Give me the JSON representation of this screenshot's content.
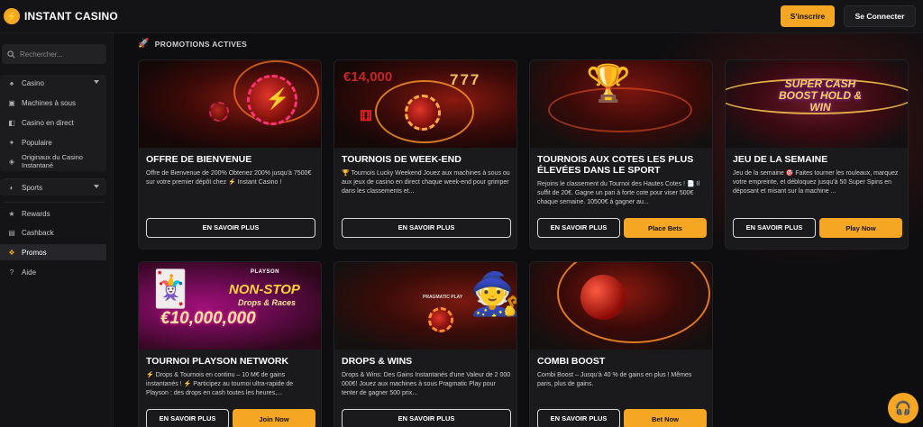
{
  "brand": {
    "name": "INSTANT CASINO",
    "logo_glyph": "⚡"
  },
  "header": {
    "signup_label": "S'inscrire",
    "login_label": "Se Connecter"
  },
  "sidebar": {
    "search_placeholder": "Rechercher...",
    "casino": {
      "label": "Casino",
      "items": [
        {
          "label": "Machines à sous",
          "icon": "slot-machine-icon"
        },
        {
          "label": "Casino en direct",
          "icon": "live-casino-icon"
        },
        {
          "label": "Populaire",
          "icon": "sparkle-icon"
        },
        {
          "label": "Originaux du Casino Instantané",
          "icon": "originals-icon"
        }
      ]
    },
    "sports": {
      "label": "Sports"
    },
    "items": [
      {
        "label": "Rewards",
        "icon": "star-icon"
      },
      {
        "label": "Cashback",
        "icon": "cashback-icon"
      },
      {
        "label": "Promos",
        "icon": "promo-icon",
        "active": true
      },
      {
        "label": "Aide",
        "icon": "help-icon"
      }
    ]
  },
  "main": {
    "section_title": "PROMOTIONS ACTIVES",
    "cards": [
      {
        "title": "OFFRE DE BIENVENUE",
        "description": "Offre de Bienvenue de 200% Obtenez 200% jusqu'à 7500€ sur votre premier dépôt chez ⚡ Instant Casino !",
        "outline_label": "EN SAVOIR PLUS"
      },
      {
        "title": "TOURNOIS DE WEEK-END",
        "image_text": "€14,000",
        "description": "🏆 Tournois Lucky Weekend Jouez aux machines à sous ou aux jeux de casino en direct chaque week-end pour grimper dans les classements et...",
        "outline_label": "EN SAVOIR PLUS"
      },
      {
        "title": "TOURNOIS AUX COTES LES PLUS ÉLEVÉES DANS LE SPORT",
        "description": "Rejoins le classement du Tournoi des Hautes Cotes ! 📄 Il suffit de 20€. Gagne un pari à forte cote pour viser 500€ chaque semaine. 10500€ à gagner au...",
        "outline_label": "EN SAVOIR PLUS",
        "gold_label": "Place Bets"
      },
      {
        "title": "JEU DE LA SEMAINE",
        "image_text": "SUPER CASH BOOST HOLD & WIN",
        "description": "Jeu de la semaine 🎯 Faites tourner les rouleaux, marquez votre empreinte, et débloquez jusqu'à 50 Super Spins en déposant et misant sur la machine ...",
        "outline_label": "EN SAVOIR PLUS",
        "gold_label": "Play Now"
      },
      {
        "title": "TOURNOI PLAYSON NETWORK",
        "image_brand": "PLAYSON",
        "image_headline": "NON-STOP",
        "image_subline": "Drops & Races",
        "image_amount": "€10,000,000",
        "description": "⚡ Drops & Tournois en continu – 10 M€ de gains instantanés ! ⚡ Participez au tournoi ultra-rapide de Playson : des drops en cash toutes les heures,...",
        "outline_label": "EN SAVOIR PLUS",
        "gold_label": "Join Now"
      },
      {
        "title": "DROPS & WINS",
        "image_brand": "PRAGMATIC PLAY",
        "description": "Drops & Wins: Des Gains Instantanés d'une Valeur de 2 000 000€! Jouez aux machines à sous Pragmatic Play pour tenter de gagner 500 prix...",
        "outline_label": "EN SAVOIR PLUS"
      },
      {
        "title": "COMBI BOOST",
        "description": "Combi Boost – Jusqu'à 40 % de gains en plus ! Mêmes paris, plus de gains.",
        "outline_label": "EN SAVOIR PLUS",
        "gold_label": "Bet Now"
      }
    ]
  },
  "colors": {
    "accent": "#f5a623",
    "background": "#0e0e10",
    "card": "#1a1a1d"
  }
}
